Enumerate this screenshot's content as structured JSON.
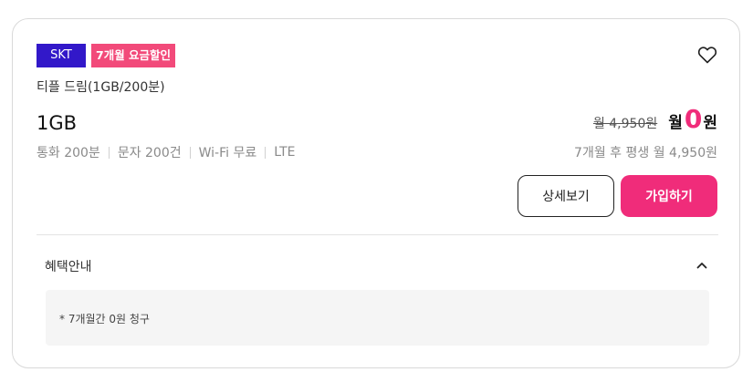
{
  "plan": {
    "carrier_badge": "SKT",
    "promo_badge": "7개월 요금할인",
    "name": "티플 드림(1GB/200분)",
    "data_amount": "1GB",
    "specs": [
      "통화 200분",
      "문자 200건",
      "Wi-Fi 무료",
      "LTE"
    ],
    "original_price": "월 4,950원",
    "price_prefix": "월",
    "price_value": "0",
    "price_suffix": "원",
    "after_price": "7개월 후 평생 월 4,950원"
  },
  "actions": {
    "detail_label": "상세보기",
    "join_label": "가입하기"
  },
  "benefit": {
    "title": "혜택안내",
    "text": "* 7개월간 0원 청구"
  },
  "icons": {
    "favorite": "heart-outline-icon",
    "collapse": "chevron-up-icon"
  },
  "colors": {
    "carrier_badge": "#3218c9",
    "promo_badge": "#f24a7a",
    "accent": "#f02c7a"
  }
}
